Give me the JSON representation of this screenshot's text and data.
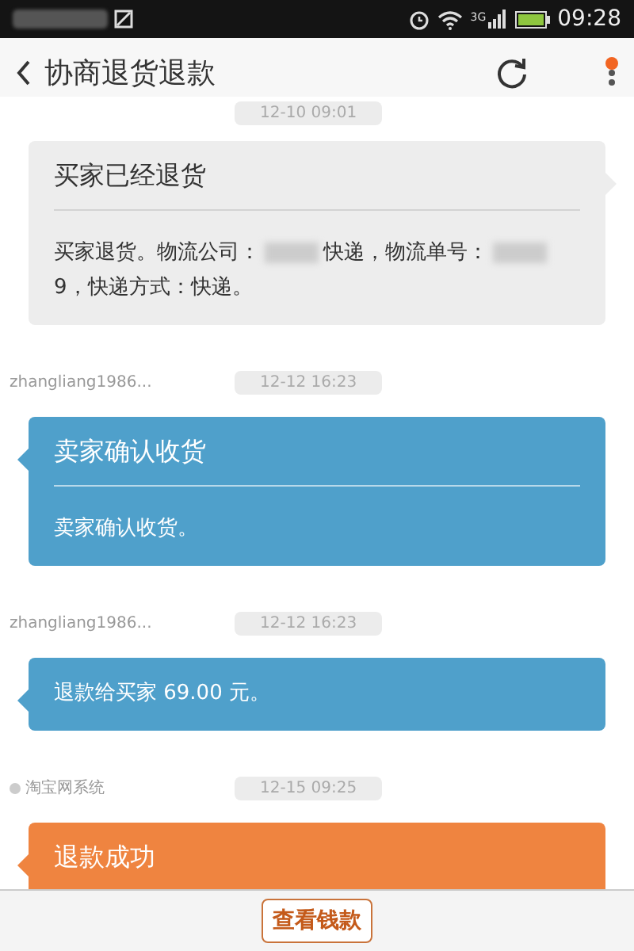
{
  "status_bar": {
    "network": "3G",
    "time": "09:28"
  },
  "header": {
    "title": "协商退货退款",
    "menu_badge": true
  },
  "messages": [
    {
      "time": "12-10 09:01",
      "kind": "outgoing",
      "color": "#ededed",
      "title": "买家已经退货",
      "body": [
        {
          "kind": "text",
          "text": "买家退货。物流公司："
        },
        {
          "kind": "redacted"
        },
        {
          "kind": "text",
          "text": "快递，物流单号："
        },
        {
          "kind": "redacted"
        },
        {
          "kind": "text",
          "text": "9，快递方式：快递。"
        }
      ]
    },
    {
      "sender": "zhangliang1986...",
      "sender_dot": false,
      "time": "12-12 16:23",
      "kind": "incoming",
      "color": "#4fa0cb",
      "title": "卖家确认收货",
      "body": [
        {
          "kind": "text",
          "text": "卖家确认收货。"
        }
      ]
    },
    {
      "sender": "zhangliang1986...",
      "sender_dot": false,
      "time": "12-12 16:23",
      "kind": "incoming",
      "color": "#4fa0cb",
      "body": [
        {
          "kind": "text",
          "text": "退款给买家 69.00 元。"
        }
      ]
    },
    {
      "sender": "淘宝网系统",
      "sender_dot": true,
      "time": "12-15 09:25",
      "kind": "incoming",
      "color": "#ef8440",
      "title": "退款成功"
    }
  ],
  "bottom_button": "查看钱款"
}
